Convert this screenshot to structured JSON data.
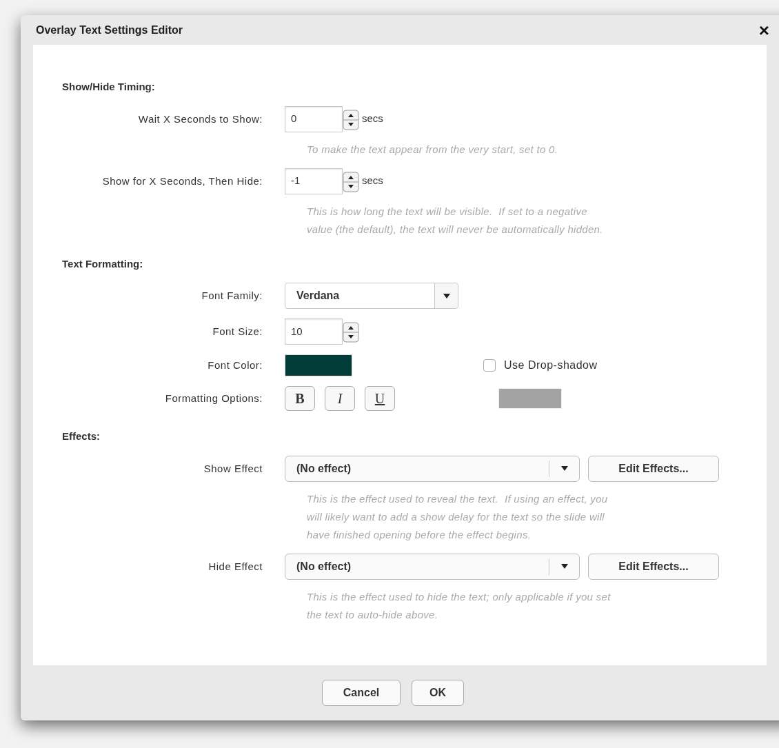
{
  "dialog": {
    "title": "Overlay Text Settings Editor",
    "close": "×"
  },
  "sections": [
    {
      "heading": "Show/Hide Timing:",
      "rows": [
        {
          "kind": "spinner",
          "label": "Wait X Seconds to Show:",
          "value": "0",
          "unit": "secs",
          "hint": [
            "To make the text appear from the very start, set to 0."
          ]
        },
        {
          "kind": "spinner",
          "label": "Show for X Seconds, Then Hide:",
          "value": "-1",
          "unit": "secs",
          "hint": [
            "This is how long the text will be visible.  If set to a negative",
            "value (the default), the text will never be automatically hidden."
          ]
        }
      ]
    },
    {
      "heading": "Text Formatting:",
      "rows": [
        {
          "kind": "dropdown",
          "label": "Font Family:",
          "value": "Verdana"
        },
        {
          "kind": "spinner",
          "label": "Font Size:",
          "value": "10"
        },
        {
          "kind": "color",
          "label": "Font Color:",
          "color": "#013d38",
          "checkbox": {
            "label": "Use Drop-shadow",
            "checked": false
          }
        },
        {
          "kind": "format",
          "label": "Formatting Options:",
          "buttons": [
            {
              "kind": "bold",
              "label": "B",
              "selected": false
            },
            {
              "kind": "italic",
              "label": "I",
              "selected": false
            },
            {
              "kind": "underline",
              "label": "U",
              "selected": false
            }
          ],
          "shadow": {
            "color": "#a3a3a3"
          }
        }
      ]
    },
    {
      "heading": "Effects:",
      "rows": [
        {
          "kind": "effect",
          "label": "Show Effect",
          "value": "(No effect)",
          "button": "Edit Effects...",
          "hint": [
            "This is the effect used to reveal the text.  If using an effect, you",
            "will likely want to add a show delay for the text so the slide will",
            "have finished opening before the effect begins."
          ]
        },
        {
          "kind": "effect",
          "label": "Hide Effect",
          "value": "(No effect)",
          "button": "Edit Effects...",
          "hint": [
            "This is the effect used to hide the text; only applicable if you set",
            "the text to auto-hide above."
          ]
        }
      ]
    }
  ],
  "footer": {
    "buttons": [
      "Cancel",
      "OK"
    ]
  }
}
